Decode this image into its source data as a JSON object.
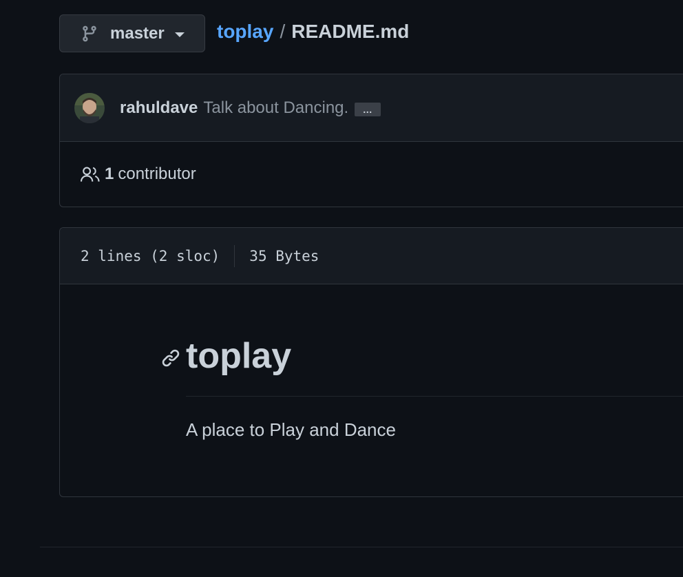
{
  "branch": {
    "name": "master",
    "icon": "git-branch-icon"
  },
  "breadcrumb": {
    "repo": "toplay",
    "separator": "/",
    "file": "README.md"
  },
  "commit": {
    "author": "rahuldave",
    "message": "Talk about Dancing.",
    "ellipsis": "…",
    "avatar_icon": "avatar"
  },
  "contributors": {
    "count": "1",
    "label": "contributor",
    "icon": "people-icon"
  },
  "file_info": {
    "lines": "2 lines (2 sloc)",
    "size": "35 Bytes"
  },
  "readme": {
    "heading": "toplay",
    "paragraph": "A place to Play and Dance",
    "anchor_icon": "link-icon"
  },
  "colors": {
    "background": "#0d1117",
    "link": "#58a6ff",
    "text": "#c9d1d9",
    "muted": "#8b949e"
  }
}
